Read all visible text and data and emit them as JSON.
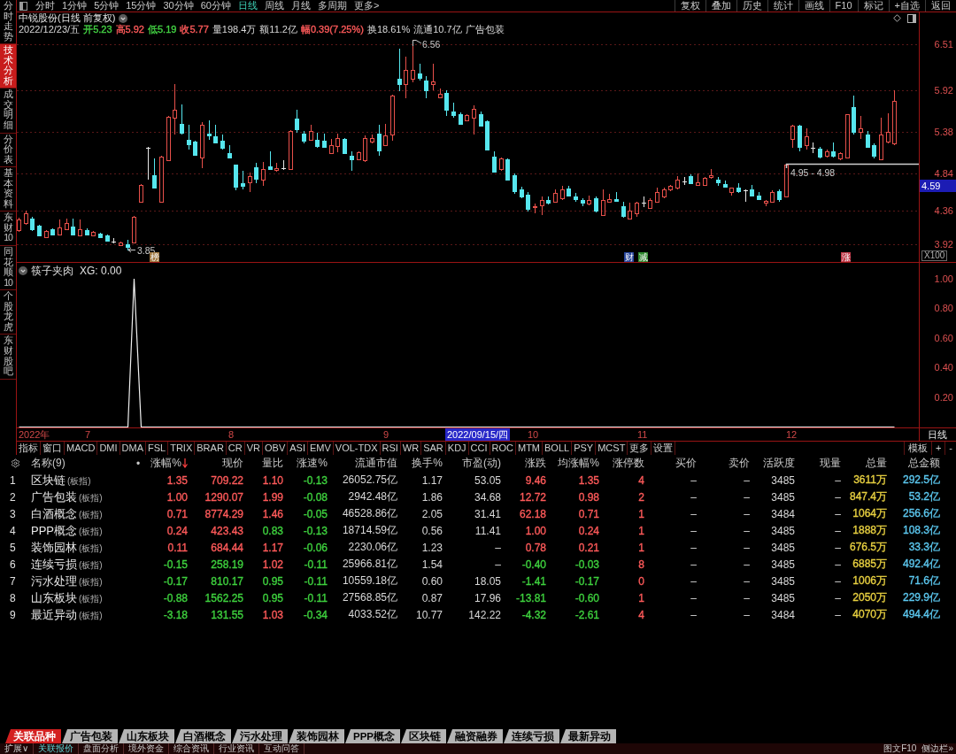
{
  "sidebar": {
    "items": [
      {
        "label": "分时走势",
        "selected": false
      },
      {
        "label": "技术分析",
        "selected": true
      },
      {
        "label": "成交明细",
        "selected": false
      },
      {
        "label": "分价表",
        "selected": false
      },
      {
        "label": "基本资料",
        "selected": false
      },
      {
        "label": "东财10",
        "selected": false
      },
      {
        "label": "同花顺10",
        "selected": false
      },
      {
        "label": "个股龙虎",
        "selected": false
      },
      {
        "label": "东财股吧",
        "selected": false
      }
    ]
  },
  "toolbar": {
    "periods": [
      {
        "label": "分时",
        "selected": false
      },
      {
        "label": "1分钟",
        "selected": false
      },
      {
        "label": "5分钟",
        "selected": false
      },
      {
        "label": "15分钟",
        "selected": false
      },
      {
        "label": "30分钟",
        "selected": false
      },
      {
        "label": "60分钟",
        "selected": false
      },
      {
        "label": "日线",
        "selected": true
      },
      {
        "label": "周线",
        "selected": false
      },
      {
        "label": "月线",
        "selected": false
      },
      {
        "label": "多周期",
        "selected": false
      },
      {
        "label": "更多>",
        "selected": false
      }
    ],
    "actions": [
      "复权",
      "叠加",
      "历史",
      "统计",
      "画线",
      "F10",
      "标记",
      "+自选",
      "返回"
    ]
  },
  "quote": {
    "title": "中锐股份(日线 前复权)",
    "date": "2022/12/23/五",
    "fields": [
      {
        "text": "开5.23",
        "color": "#44d444"
      },
      {
        "text": "高5.92",
        "color": "#ff5a5a"
      },
      {
        "text": "低5.19",
        "color": "#44d444"
      },
      {
        "text": "收5.77",
        "color": "#ff5a5a"
      },
      {
        "text": "量198.4万"
      },
      {
        "text": "额11.2亿"
      },
      {
        "text": "幅0.39(7.25%)",
        "color": "#ff5a5a"
      },
      {
        "text": "换18.61%"
      },
      {
        "text": "流通10.7亿"
      },
      {
        "text": "广告包装"
      }
    ]
  },
  "price_chart": {
    "axis_labels": [
      "6.51",
      "5.92",
      "5.38",
      "4.84",
      "4.36",
      "3.92"
    ],
    "current_price": "4.59",
    "scale": "X100",
    "high_label": "6.56",
    "low_label": "3.85",
    "gap_label": "4.95 - 4.98",
    "markers": [
      {
        "text": "榜",
        "color": "#a07840"
      },
      {
        "text": "财",
        "color": "#24449c"
      },
      {
        "text": "减",
        "color": "#2e8a2e"
      },
      {
        "text": "涨",
        "color": "#c23a4a"
      }
    ]
  },
  "indicator": {
    "title": "筷子夹肉",
    "reading": "XG: 0.00",
    "axis_labels": [
      "1.00",
      "0.80",
      "0.60",
      "0.40",
      "0.20"
    ]
  },
  "time_axis": {
    "labels": [
      "2022年",
      "7",
      "8",
      "9",
      "10",
      "11",
      "12"
    ],
    "cursor": "2022/09/15/四",
    "period": "日线"
  },
  "indicator_tabs": {
    "items": [
      "指标",
      "窗口",
      "MACD",
      "DMI",
      "DMA",
      "FSL",
      "TRIX",
      "BRAR",
      "CR",
      "VR",
      "OBV",
      "ASI",
      "EMV",
      "VOL-TDX",
      "RSI",
      "WR",
      "SAR",
      "KDJ",
      "CCI",
      "ROC",
      "MTM",
      "BOLL",
      "PSY",
      "MCST",
      "更多",
      "设置"
    ],
    "tools": [
      "模板",
      "+",
      "-"
    ]
  },
  "table": {
    "name_header": "名称(9)",
    "mark_header": "•",
    "columns": [
      {
        "label": "涨幅%",
        "sorted": true
      },
      {
        "label": "现价",
        "sorted": false
      },
      {
        "label": "量比",
        "sorted": false
      },
      {
        "label": "涨速%",
        "sorted": false
      },
      {
        "label": "流通市值",
        "sorted": false
      },
      {
        "label": "换手%",
        "sorted": false
      },
      {
        "label": "市盈(动)",
        "sorted": false
      },
      {
        "label": "涨跌",
        "sorted": false
      },
      {
        "label": "均涨幅%",
        "sorted": false
      },
      {
        "label": "涨停数",
        "sorted": false
      },
      {
        "label": "买价",
        "sorted": false
      },
      {
        "label": "卖价",
        "sorted": false
      },
      {
        "label": "活跃度",
        "sorted": false
      },
      {
        "label": "现量",
        "sorted": false
      },
      {
        "label": "总量",
        "sorted": false
      },
      {
        "label": "总金额",
        "sorted": false
      }
    ],
    "rows": [
      {
        "no": "1",
        "name": "区块链",
        "tag": "(板指)",
        "cells": [
          {
            "text": "1.35",
            "color": "#ff5a5a"
          },
          {
            "text": "709.22",
            "color": "#ff5a5a"
          },
          {
            "text": "1.10",
            "color": "#ff5a5a"
          },
          {
            "text": "-0.13",
            "color": "#3ed23e"
          },
          {
            "text": "26052.75亿"
          },
          {
            "text": "1.17"
          },
          {
            "text": "53.05"
          },
          {
            "text": "9.46",
            "color": "#ff5a5a"
          },
          {
            "text": "1.35",
            "color": "#ff5a5a"
          },
          {
            "text": "4",
            "color": "#ff5a5a"
          },
          {
            "text": "–"
          },
          {
            "text": "–"
          },
          {
            "text": "3485"
          },
          {
            "text": "–"
          },
          {
            "text": "3611万",
            "color": "#e8d040"
          },
          {
            "text": "292.5亿",
            "color": "#5cc8f0"
          }
        ]
      },
      {
        "no": "2",
        "name": "广告包装",
        "tag": "(板指)",
        "cells": [
          {
            "text": "1.00",
            "color": "#ff5a5a"
          },
          {
            "text": "1290.07",
            "color": "#ff5a5a"
          },
          {
            "text": "1.99",
            "color": "#ff5a5a"
          },
          {
            "text": "-0.08",
            "color": "#3ed23e"
          },
          {
            "text": "2942.48亿"
          },
          {
            "text": "1.86"
          },
          {
            "text": "34.68"
          },
          {
            "text": "12.72",
            "color": "#ff5a5a"
          },
          {
            "text": "0.98",
            "color": "#ff5a5a"
          },
          {
            "text": "2",
            "color": "#ff5a5a"
          },
          {
            "text": "–"
          },
          {
            "text": "–"
          },
          {
            "text": "3485"
          },
          {
            "text": "–"
          },
          {
            "text": "847.4万",
            "color": "#e8d040"
          },
          {
            "text": "53.2亿",
            "color": "#5cc8f0"
          }
        ]
      },
      {
        "no": "3",
        "name": "白酒概念",
        "tag": "(板指)",
        "cells": [
          {
            "text": "0.71",
            "color": "#ff5a5a"
          },
          {
            "text": "8774.29",
            "color": "#ff5a5a"
          },
          {
            "text": "1.46",
            "color": "#ff5a5a"
          },
          {
            "text": "-0.05",
            "color": "#3ed23e"
          },
          {
            "text": "46528.86亿"
          },
          {
            "text": "2.05"
          },
          {
            "text": "31.41"
          },
          {
            "text": "62.18",
            "color": "#ff5a5a"
          },
          {
            "text": "0.71",
            "color": "#ff5a5a"
          },
          {
            "text": "1",
            "color": "#ff5a5a"
          },
          {
            "text": "–"
          },
          {
            "text": "–"
          },
          {
            "text": "3484"
          },
          {
            "text": "–"
          },
          {
            "text": "1064万",
            "color": "#e8d040"
          },
          {
            "text": "256.6亿",
            "color": "#5cc8f0"
          }
        ]
      },
      {
        "no": "4",
        "name": "PPP概念",
        "tag": "(板指)",
        "cells": [
          {
            "text": "0.24",
            "color": "#ff5a5a"
          },
          {
            "text": "423.43",
            "color": "#ff5a5a"
          },
          {
            "text": "0.83",
            "color": "#3ed23e"
          },
          {
            "text": "-0.13",
            "color": "#3ed23e"
          },
          {
            "text": "18714.59亿"
          },
          {
            "text": "0.56"
          },
          {
            "text": "11.41"
          },
          {
            "text": "1.00",
            "color": "#ff5a5a"
          },
          {
            "text": "0.24",
            "color": "#ff5a5a"
          },
          {
            "text": "1",
            "color": "#ff5a5a"
          },
          {
            "text": "–"
          },
          {
            "text": "–"
          },
          {
            "text": "3485"
          },
          {
            "text": "–"
          },
          {
            "text": "1888万",
            "color": "#e8d040"
          },
          {
            "text": "108.3亿",
            "color": "#5cc8f0"
          }
        ]
      },
      {
        "no": "5",
        "name": "装饰园林",
        "tag": "(板指)",
        "cells": [
          {
            "text": "0.11",
            "color": "#ff5a5a"
          },
          {
            "text": "684.44",
            "color": "#ff5a5a"
          },
          {
            "text": "1.17",
            "color": "#ff5a5a"
          },
          {
            "text": "-0.06",
            "color": "#3ed23e"
          },
          {
            "text": "2230.06亿"
          },
          {
            "text": "1.23"
          },
          {
            "text": "–"
          },
          {
            "text": "0.78",
            "color": "#ff5a5a"
          },
          {
            "text": "0.21",
            "color": "#ff5a5a"
          },
          {
            "text": "1",
            "color": "#ff5a5a"
          },
          {
            "text": "–"
          },
          {
            "text": "–"
          },
          {
            "text": "3485"
          },
          {
            "text": "–"
          },
          {
            "text": "676.5万",
            "color": "#e8d040"
          },
          {
            "text": "33.3亿",
            "color": "#5cc8f0"
          }
        ]
      },
      {
        "no": "6",
        "name": "连续亏损",
        "tag": "(板指)",
        "cells": [
          {
            "text": "-0.15",
            "color": "#3ed23e"
          },
          {
            "text": "258.19",
            "color": "#3ed23e"
          },
          {
            "text": "1.02",
            "color": "#ff5a5a"
          },
          {
            "text": "-0.11",
            "color": "#3ed23e"
          },
          {
            "text": "25966.81亿"
          },
          {
            "text": "1.54"
          },
          {
            "text": "–"
          },
          {
            "text": "-0.40",
            "color": "#3ed23e"
          },
          {
            "text": "-0.03",
            "color": "#3ed23e"
          },
          {
            "text": "8",
            "color": "#ff5a5a"
          },
          {
            "text": "–"
          },
          {
            "text": "–"
          },
          {
            "text": "3485"
          },
          {
            "text": "–"
          },
          {
            "text": "6885万",
            "color": "#e8d040"
          },
          {
            "text": "492.4亿",
            "color": "#5cc8f0"
          }
        ]
      },
      {
        "no": "7",
        "name": "污水处理",
        "tag": "(板指)",
        "cells": [
          {
            "text": "-0.17",
            "color": "#3ed23e"
          },
          {
            "text": "810.17",
            "color": "#3ed23e"
          },
          {
            "text": "0.95",
            "color": "#3ed23e"
          },
          {
            "text": "-0.11",
            "color": "#3ed23e"
          },
          {
            "text": "10559.18亿"
          },
          {
            "text": "0.60"
          },
          {
            "text": "18.05"
          },
          {
            "text": "-1.41",
            "color": "#3ed23e"
          },
          {
            "text": "-0.17",
            "color": "#3ed23e"
          },
          {
            "text": "0",
            "color": "#ff5a5a"
          },
          {
            "text": "–"
          },
          {
            "text": "–"
          },
          {
            "text": "3485"
          },
          {
            "text": "–"
          },
          {
            "text": "1006万",
            "color": "#e8d040"
          },
          {
            "text": "71.6亿",
            "color": "#5cc8f0"
          }
        ]
      },
      {
        "no": "8",
        "name": "山东板块",
        "tag": "(板指)",
        "cells": [
          {
            "text": "-0.88",
            "color": "#3ed23e"
          },
          {
            "text": "1562.25",
            "color": "#3ed23e"
          },
          {
            "text": "0.95",
            "color": "#3ed23e"
          },
          {
            "text": "-0.11",
            "color": "#3ed23e"
          },
          {
            "text": "27568.85亿"
          },
          {
            "text": "0.87"
          },
          {
            "text": "17.96"
          },
          {
            "text": "-13.81",
            "color": "#3ed23e"
          },
          {
            "text": "-0.60",
            "color": "#3ed23e"
          },
          {
            "text": "1",
            "color": "#ff5a5a"
          },
          {
            "text": "–"
          },
          {
            "text": "–"
          },
          {
            "text": "3485"
          },
          {
            "text": "–"
          },
          {
            "text": "2050万",
            "color": "#e8d040"
          },
          {
            "text": "229.9亿",
            "color": "#5cc8f0"
          }
        ]
      },
      {
        "no": "9",
        "name": "最近异动",
        "tag": "(板指)",
        "cells": [
          {
            "text": "-3.18",
            "color": "#3ed23e"
          },
          {
            "text": "131.55",
            "color": "#3ed23e"
          },
          {
            "text": "1.03",
            "color": "#ff5a5a"
          },
          {
            "text": "-0.34",
            "color": "#3ed23e"
          },
          {
            "text": "4033.52亿"
          },
          {
            "text": "10.77"
          },
          {
            "text": "142.22"
          },
          {
            "text": "-4.32",
            "color": "#3ed23e"
          },
          {
            "text": "-2.61",
            "color": "#3ed23e"
          },
          {
            "text": "4",
            "color": "#ff5a5a"
          },
          {
            "text": "–"
          },
          {
            "text": "–"
          },
          {
            "text": "3484"
          },
          {
            "text": "–"
          },
          {
            "text": "4070万",
            "color": "#e8d040"
          },
          {
            "text": "494.4亿",
            "color": "#5cc8f0"
          }
        ]
      }
    ]
  },
  "sector_tabs": [
    {
      "label": "关联品种",
      "selected": true
    },
    {
      "label": "广告包装",
      "selected": false
    },
    {
      "label": "山东板块",
      "selected": false
    },
    {
      "label": "白酒概念",
      "selected": false
    },
    {
      "label": "污水处理",
      "selected": false
    },
    {
      "label": "装饰园林",
      "selected": false
    },
    {
      "label": "PPP概念",
      "selected": false
    },
    {
      "label": "区块链",
      "selected": false
    },
    {
      "label": "融资融券",
      "selected": false
    },
    {
      "label": "连续亏损",
      "selected": false
    },
    {
      "label": "最新异动",
      "selected": false
    }
  ],
  "status_bar": {
    "items": [
      {
        "label": "扩展∨",
        "selected": false
      },
      {
        "label": "关联报价",
        "selected": true
      },
      {
        "label": "盘面分析",
        "selected": false
      },
      {
        "label": "境外资金",
        "selected": false
      },
      {
        "label": "综合资讯",
        "selected": false
      },
      {
        "label": "行业资讯",
        "selected": false
      },
      {
        "label": "互动问答",
        "selected": false
      }
    ],
    "right": [
      "图文F10",
      "侧边栏»"
    ]
  }
}
